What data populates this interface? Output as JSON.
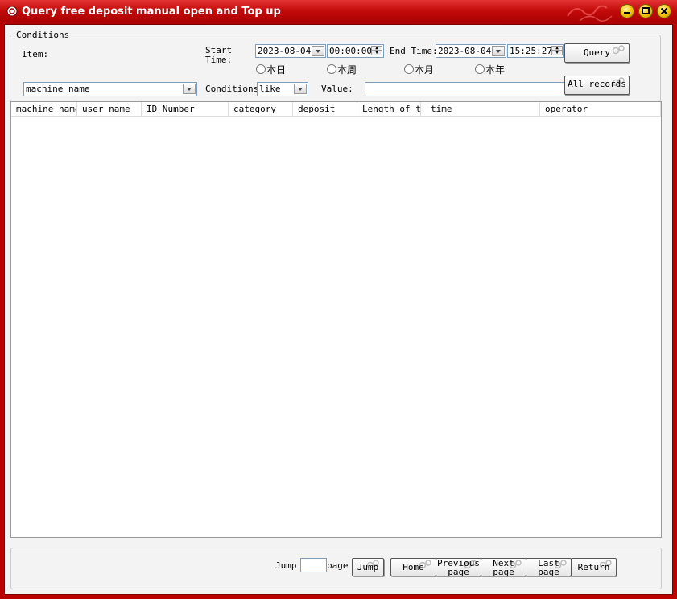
{
  "window": {
    "title": "Query free deposit manual open and Top up"
  },
  "conditions": {
    "legend": "Conditions",
    "item_label": "Item:",
    "start_time_label": "Start\nTime:",
    "start_date": "2023-08-04",
    "start_time": "00:00:00",
    "end_time_label": "End Time:",
    "end_date": "2023-08-04",
    "end_time": "15:25:27",
    "query_button": "Query",
    "all_records_button": "All records",
    "radios": [
      "本日",
      "本周",
      "本月",
      "本年"
    ],
    "item_select": "machine name",
    "conditions_label": "Conditions:",
    "conditions_select": "like",
    "value_label": "Value:",
    "value": ""
  },
  "table": {
    "columns": [
      "machine name",
      "user name",
      "ID Number",
      "category",
      "deposit",
      "Length of time",
      "time",
      "operator"
    ],
    "rows": []
  },
  "pager": {
    "jump_label": "Jump",
    "jump_value": "",
    "page_label": "page",
    "jump_button": "Jump",
    "home_button": "Home",
    "previous_button": "Previous page",
    "next_button": "Next page",
    "last_button": "Last page",
    "return_button": "Return"
  },
  "colors": {
    "title_bar": "#c20b0b",
    "client_bg": "#f3f3f3",
    "control_border": "#7f9db9"
  }
}
